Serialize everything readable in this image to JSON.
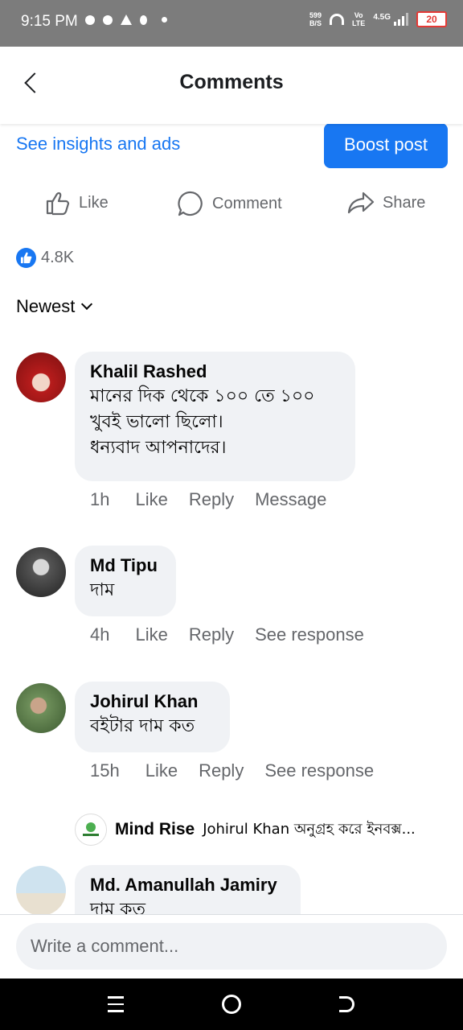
{
  "status_bar": {
    "time": "9:15 PM",
    "speed_value": "599",
    "speed_unit": "B/S",
    "volte_top": "Vo",
    "volte_bottom": "LTE",
    "network": "4.5G",
    "battery": "20"
  },
  "header": {
    "title": "Comments",
    "back_icon": "chevron-left-icon"
  },
  "insights": {
    "link_label": "See insights and ads",
    "boost_label": "Boost post",
    "accent": "#1877f2"
  },
  "actions": {
    "like_label": "Like",
    "comment_label": "Comment",
    "share_label": "Share"
  },
  "reactions": {
    "count": "4.8K"
  },
  "sort": {
    "label": "Newest"
  },
  "comments": [
    {
      "name": "Khalil Rashed",
      "lines": [
        "মানের দিক থেকে ১০০ তে ১০০",
        "খুবই ভালো ছিলো।",
        "ধন্যবাদ আপনাদের।"
      ],
      "time": "1h",
      "like": "Like",
      "reply": "Reply",
      "extra": "Message"
    },
    {
      "name": "Md Tipu",
      "lines": [
        "দাম"
      ],
      "time": "4h",
      "like": "Like",
      "reply": "Reply",
      "extra": "See response"
    },
    {
      "name": "Johirul Khan",
      "lines": [
        "বইটার দাম কত"
      ],
      "time": "15h",
      "like": "Like",
      "reply": "Reply",
      "extra": "See response",
      "reply_preview": {
        "name": "Mind Rise",
        "text": "Johirul Khan অনুগ্রহ করে ইনবক্স..."
      }
    },
    {
      "name": "Md. Amanullah Jamiry",
      "lines": [
        "দাম কত"
      ]
    }
  ],
  "composer": {
    "placeholder": "Write a comment..."
  }
}
